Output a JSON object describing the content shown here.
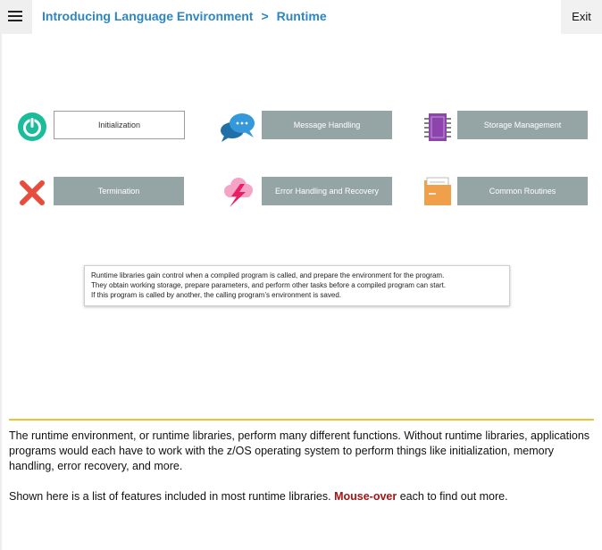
{
  "header": {
    "breadcrumb": [
      "Introducing Language Environment",
      "Runtime"
    ],
    "separator": ">",
    "exit_label": "Exit"
  },
  "features": [
    {
      "label": "Initialization",
      "icon": "power-icon",
      "selected": true
    },
    {
      "label": "Message Handling",
      "icon": "speech-bubbles-icon",
      "selected": false
    },
    {
      "label": "Storage Management",
      "icon": "memory-chip-icon",
      "selected": false
    },
    {
      "label": "Termination",
      "icon": "x-mark-icon",
      "selected": false
    },
    {
      "label": "Error Handling and Recovery",
      "icon": "storm-cloud-icon",
      "selected": false
    },
    {
      "label": "Common Routines",
      "icon": "folder-icon",
      "selected": false
    }
  ],
  "description": [
    "Runtime libraries gain control when a compiled program is called, and prepare the environment for the program.",
    "They obtain working storage, prepare parameters, and perform other tasks before a compiled program can start.",
    "If this program is called by another, the calling program’s environment is saved."
  ],
  "body": {
    "paragraph1": "The runtime environment, or runtime libraries, perform many different functions. Without runtime libraries, applications programs would each have to work with the z/OS operating system to perform things like initialization, memory handling, error recovery, and more.",
    "paragraph2_prefix": "Shown here is a list of features included in most runtime libraries. ",
    "paragraph2_highlight": "Mouse-over",
    "paragraph2_suffix": " each to find out more."
  },
  "colors": {
    "breadcrumb": "#2e86c1",
    "tile": "#95a5a6",
    "divider": "#f0c23a",
    "highlight": "#a31515",
    "power": "#1abc9c",
    "chat": "#2e86c1",
    "chip": "#8e44ad",
    "close": "#e74c3c",
    "storm": "#f08ab4",
    "folder": "#f0a04b"
  }
}
